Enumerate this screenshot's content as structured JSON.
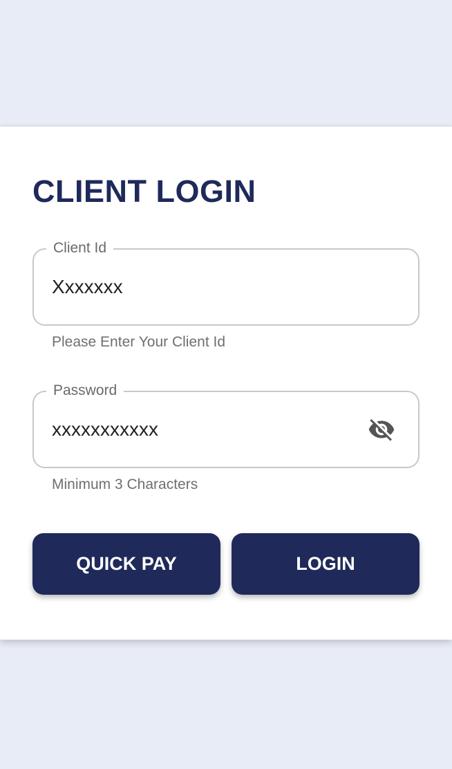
{
  "login": {
    "title": "CLIENT LOGIN",
    "client_id": {
      "label": "Client Id",
      "value": "Xxxxxxx",
      "helper": "Please Enter Your Client Id"
    },
    "password": {
      "label": "Password",
      "value": "xxxxxxxxxxx",
      "helper": "Minimum 3 Characters",
      "toggle_icon": "eye-off-icon"
    },
    "buttons": {
      "quick_pay": "QUICK PAY",
      "login": "LOGIN"
    }
  },
  "colors": {
    "background": "#e8ecf6",
    "card": "#ffffff",
    "accent": "#1f2a5a",
    "field_border": "#c8c8c8"
  }
}
